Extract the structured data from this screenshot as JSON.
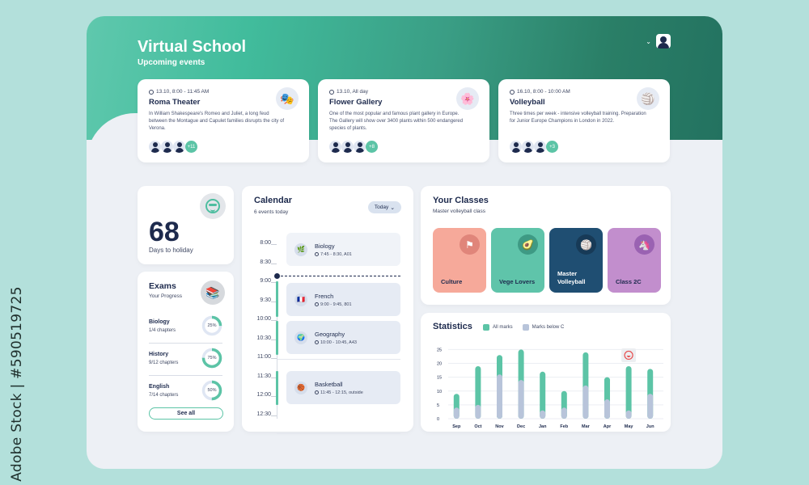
{
  "watermark": {
    "side_text": "Adobe Stock | #590519725",
    "overlay_text": "Adobe Stock"
  },
  "header": {
    "title": "Virtual School",
    "subtitle": "Upcoming events"
  },
  "events": [
    {
      "time": "13.10, 8:00 - 11:45 AM",
      "title": "Roma Theater",
      "description": "In William Shakespeare's Romeo and Juliet, a long feud between the Montague and Capulet families disrupts the city of Verona.",
      "icon": "theater-masks-icon",
      "glyph": "🎭",
      "extra_attendees": "+11"
    },
    {
      "time": "13.10, All day",
      "title": "Flower Gallery",
      "description": "One of the most popular and famous plant gallery in Europe. The Gallery will show over 3400 plants within 500 endangered species of plants.",
      "icon": "flower-icon",
      "glyph": "🌸",
      "extra_attendees": "+8"
    },
    {
      "time": "16.10, 8:00 - 10:00 AM",
      "title": "Volleyball",
      "description": "Three times per week - intensive volleyball training. Preparation for Junior Europe Champions in London in 2022.",
      "icon": "volleyball-icon",
      "glyph": "🏐",
      "extra_attendees": "+3"
    }
  ],
  "holiday": {
    "days": "68",
    "label": "Days to holiday"
  },
  "exams": {
    "title": "Exams",
    "subtitle": "Your Progress",
    "items": [
      {
        "subject": "Biology",
        "chapters": "1/4 chapters",
        "percent_label": "25%",
        "progress": 0.25
      },
      {
        "subject": "History",
        "chapters": "9/12 chapters",
        "percent_label": "75%",
        "progress": 0.75
      },
      {
        "subject": "English",
        "chapters": "7/14 chapters",
        "percent_label": "50%",
        "progress": 0.5
      }
    ],
    "see_all": "See all"
  },
  "calendar": {
    "title": "Calendar",
    "subtitle": "6 events today",
    "filter": "Today",
    "times": [
      "8:00",
      "8:30",
      "9:00",
      "9:30",
      "10:00",
      "10:30",
      "11:00",
      "11:30",
      "12:00",
      "12:30"
    ],
    "events": [
      {
        "name": "Biology",
        "time": "7:45 - 8:30, A01",
        "glyph": "🌿"
      },
      {
        "name": "French",
        "time": "9:00 - 9:45, 801",
        "glyph": "🇫🇷"
      },
      {
        "name": "Geography",
        "time": "10:00 - 10:45, A43",
        "glyph": "🌍"
      },
      {
        "name": "Basketball",
        "time": "11:45 - 12:15, outside",
        "glyph": "🏀"
      }
    ]
  },
  "classes": {
    "title": "Your Classes",
    "subtitle": "Master volleyball class",
    "items": [
      {
        "label": "Culture",
        "glyph": "⚑",
        "bg": "#f6a99a",
        "icon_bg": "#e0857a",
        "text": "#1d2a4d"
      },
      {
        "label": "Vege Lovers",
        "glyph": "🥑",
        "bg": "#5fc4aa",
        "icon_bg": "#3e9a84",
        "text": "#1d2a4d"
      },
      {
        "label": "Master Volleyball",
        "glyph": "🏐",
        "bg": "#1f4e72",
        "icon_bg": "#173a57",
        "text": "#ffffff"
      },
      {
        "label": "Class 2C",
        "glyph": "🦄",
        "bg": "#c28ecd",
        "icon_bg": "#9a62b2",
        "text": "#1d2a4d"
      }
    ]
  },
  "statistics": {
    "title": "Statistics",
    "marker_glyph": "😀"
  },
  "chart_data": {
    "type": "bar",
    "title": "Statistics",
    "categories": [
      "Sep",
      "Oct",
      "Nov",
      "Dec",
      "Jan",
      "Feb",
      "Mar",
      "Apr",
      "May",
      "Jun"
    ],
    "series": [
      {
        "name": "All marks",
        "color": "#5cc4a6",
        "values": [
          9,
          19,
          23,
          25,
          17,
          10,
          24,
          15,
          19,
          18
        ]
      },
      {
        "name": "Marks below C",
        "color": "#b8c4da",
        "values": [
          4,
          5,
          16,
          14,
          3,
          4,
          12,
          7,
          3,
          9
        ]
      }
    ],
    "yticks": [
      0,
      5,
      10,
      15,
      20,
      25
    ],
    "ylim": [
      0,
      26
    ],
    "grid": true,
    "legend": "top",
    "annotation": {
      "category": "May",
      "label": "smiley marker"
    }
  },
  "colors": {
    "accent": "#5cc4a6",
    "dark": "#1d2a4d"
  }
}
